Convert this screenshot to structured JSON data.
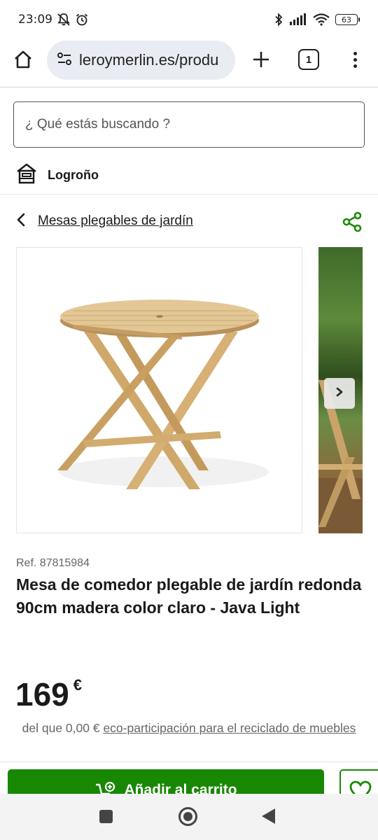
{
  "status_bar": {
    "time": "23:09",
    "battery": "63",
    "icons": [
      "notifications-off-icon",
      "alarm-icon",
      "bluetooth-icon",
      "signal-icon",
      "wifi-icon",
      "battery-icon"
    ]
  },
  "browser": {
    "url": "leroymerlin.es/produ",
    "tab_count": "1",
    "icons": [
      "home-icon",
      "site-settings-icon",
      "plus-icon",
      "tabs-icon",
      "more-vert-icon"
    ]
  },
  "search": {
    "placeholder": "¿ Qué estás buscando ?"
  },
  "store": {
    "name": "Logroño",
    "icon": "store-icon"
  },
  "breadcrumb": {
    "label": "Mesas plegables de jardín",
    "back_icon": "chevron-left-icon",
    "share_icon": "share-icon"
  },
  "gallery": {
    "main_image": "round-folding-wooden-table",
    "next_image": "table-in-garden-photo",
    "next_icon": "chevron-right-icon"
  },
  "product": {
    "ref": "Ref. 87815984",
    "title": "Mesa de comedor plegable de jardín redonda 90cm madera color claro - Java Light",
    "price_integer": "169",
    "price_currency": "€",
    "eco_prefix": "del que 0,00 € ",
    "eco_link": "eco-participación para el reciclado de muebles"
  },
  "actions": {
    "add_to_cart": "Añadir al carrito",
    "cart_icon": "cart-add-icon",
    "wishlist_icon": "heart-icon"
  },
  "colors": {
    "primary_green": "#188803",
    "share_green": "#188803",
    "url_pill_bg": "#e9ecf3"
  }
}
